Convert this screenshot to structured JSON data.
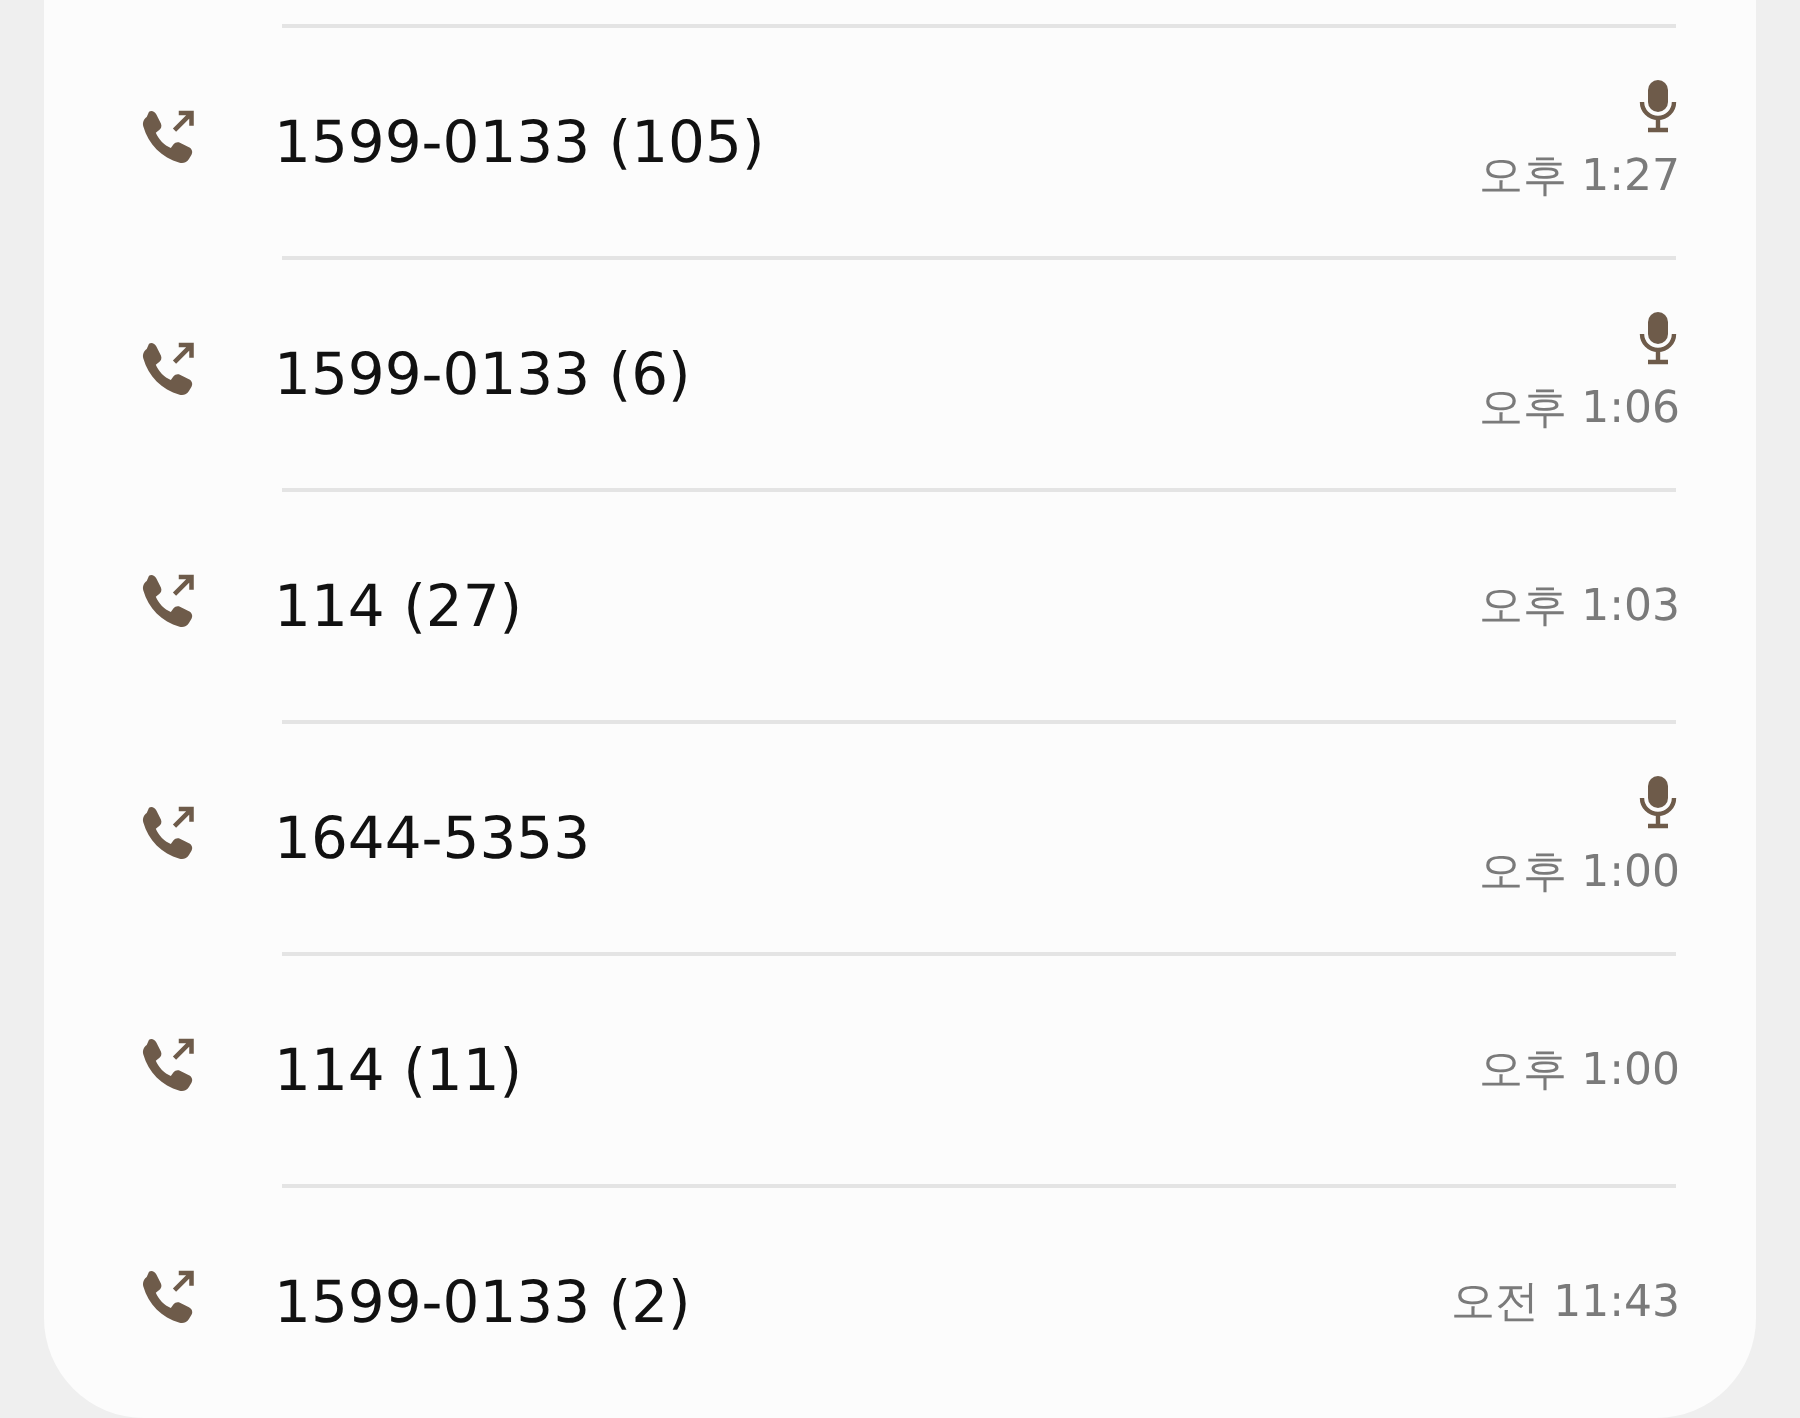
{
  "calls": [
    {
      "number": "1599-0133 (105)",
      "time": "오후 1:27",
      "recorded": true
    },
    {
      "number": "1599-0133 (6)",
      "time": "오후 1:06",
      "recorded": true
    },
    {
      "number": "114 (27)",
      "time": "오후 1:03",
      "recorded": false
    },
    {
      "number": "1644-5353",
      "time": "오후 1:00",
      "recorded": true
    },
    {
      "number": "114 (11)",
      "time": "오후 1:00",
      "recorded": false
    },
    {
      "number": "1599-0133 (2)",
      "time": "오전 11:43",
      "recorded": false
    }
  ]
}
